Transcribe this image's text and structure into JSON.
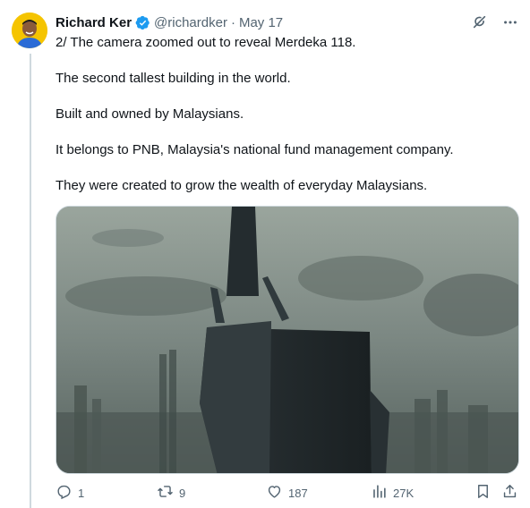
{
  "tweet": {
    "author_name": "Richard Ker",
    "handle": "@richardker",
    "separator": "·",
    "date": "May 17",
    "paragraphs": [
      "2/ The camera zoomed out to reveal Merdeka 118.",
      "The second tallest building in the world.",
      "Built and owned by Malaysians.",
      "It belongs to PNB, Malaysia's national fund management company.",
      "They were created to grow the wealth of everyday Malaysians."
    ]
  },
  "actions": {
    "replies": "1",
    "reposts": "9",
    "likes": "187",
    "views": "27K"
  },
  "icons": {
    "verified": "verified-badge-icon",
    "grok": "grok-icon",
    "more": "more-icon",
    "reply": "reply-icon",
    "repost": "repost-icon",
    "like": "like-icon",
    "views": "views-icon",
    "bookmark": "bookmark-icon",
    "share": "share-icon"
  },
  "colors": {
    "verified_blue": "#1d9bf0",
    "secondary_text": "#536471",
    "avatar_bg": "#f5c400"
  }
}
